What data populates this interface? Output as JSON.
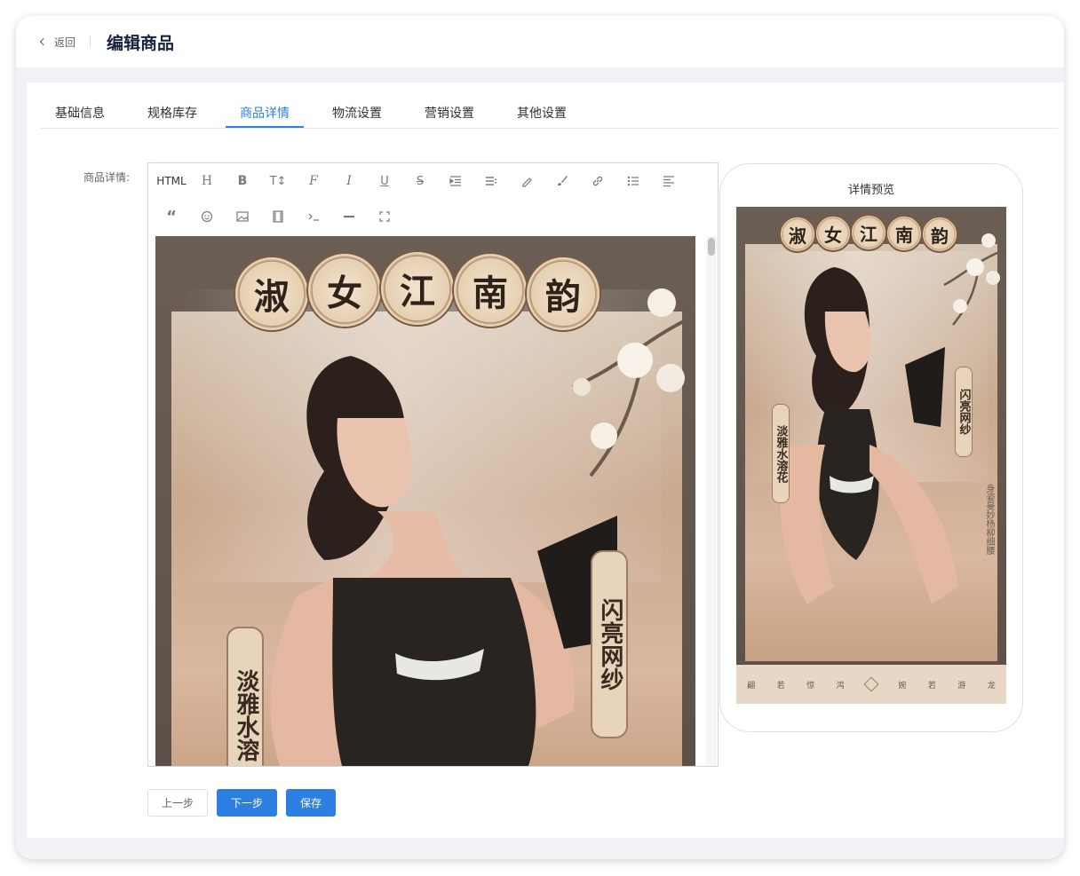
{
  "header": {
    "back_label": "返回",
    "title": "编辑商品"
  },
  "tabs": [
    {
      "label": "基础信息"
    },
    {
      "label": "规格库存"
    },
    {
      "label": "商品详情",
      "active": true
    },
    {
      "label": "物流设置"
    },
    {
      "label": "营销设置"
    },
    {
      "label": "其他设置"
    }
  ],
  "form": {
    "detail_label": "商品详情:"
  },
  "editor": {
    "toolbar": [
      {
        "label": "HTML",
        "icon": "html-icon"
      },
      {
        "label": "H",
        "icon": "heading-icon"
      },
      {
        "label": "B",
        "icon": "bold-icon"
      },
      {
        "label": "T↕",
        "icon": "font-size-icon"
      },
      {
        "label": "F",
        "icon": "font-family-icon"
      },
      {
        "label": "I",
        "icon": "italic-icon"
      },
      {
        "label": "U",
        "icon": "underline-icon"
      },
      {
        "label": "S",
        "icon": "strikethrough-icon"
      },
      {
        "label": "",
        "icon": "indent-icon"
      },
      {
        "label": "",
        "icon": "line-height-icon"
      },
      {
        "label": "",
        "icon": "font-color-icon"
      },
      {
        "label": "",
        "icon": "background-color-icon"
      },
      {
        "label": "",
        "icon": "link-icon"
      },
      {
        "label": "",
        "icon": "list-icon"
      },
      {
        "label": "",
        "icon": "align-icon"
      },
      {
        "label": "“",
        "icon": "quote-icon"
      },
      {
        "label": "",
        "icon": "emoji-icon"
      },
      {
        "label": "",
        "icon": "image-icon"
      },
      {
        "label": "",
        "icon": "video-icon"
      },
      {
        "label": "",
        "icon": "code-icon"
      },
      {
        "label": "",
        "icon": "divider-icon"
      },
      {
        "label": "",
        "icon": "fullscreen-icon"
      }
    ],
    "poster": {
      "title_chars": [
        "淑",
        "女",
        "江",
        "南",
        "韵"
      ],
      "left_banner": "淡雅水溶",
      "right_banner": "闪亮网纱"
    }
  },
  "preview": {
    "title": "详情预览",
    "poster": {
      "title_chars": [
        "淑",
        "女",
        "江",
        "南",
        "韵"
      ],
      "left_banner": "淡雅水溶花",
      "right_banner": "闪亮网纱",
      "side_text": "身姿曼妙杨柳细腰",
      "footer_left": [
        "翩",
        "若",
        "惊",
        "鸿"
      ],
      "footer_right": [
        "婉",
        "若",
        "游",
        "龙"
      ]
    }
  },
  "actions": {
    "prev_label": "上一步",
    "next_label": "下一步",
    "save_label": "保存"
  },
  "colors": {
    "primary": "#2d7fe3",
    "border": "#dcdfe6",
    "background": "#f0f2f5"
  }
}
